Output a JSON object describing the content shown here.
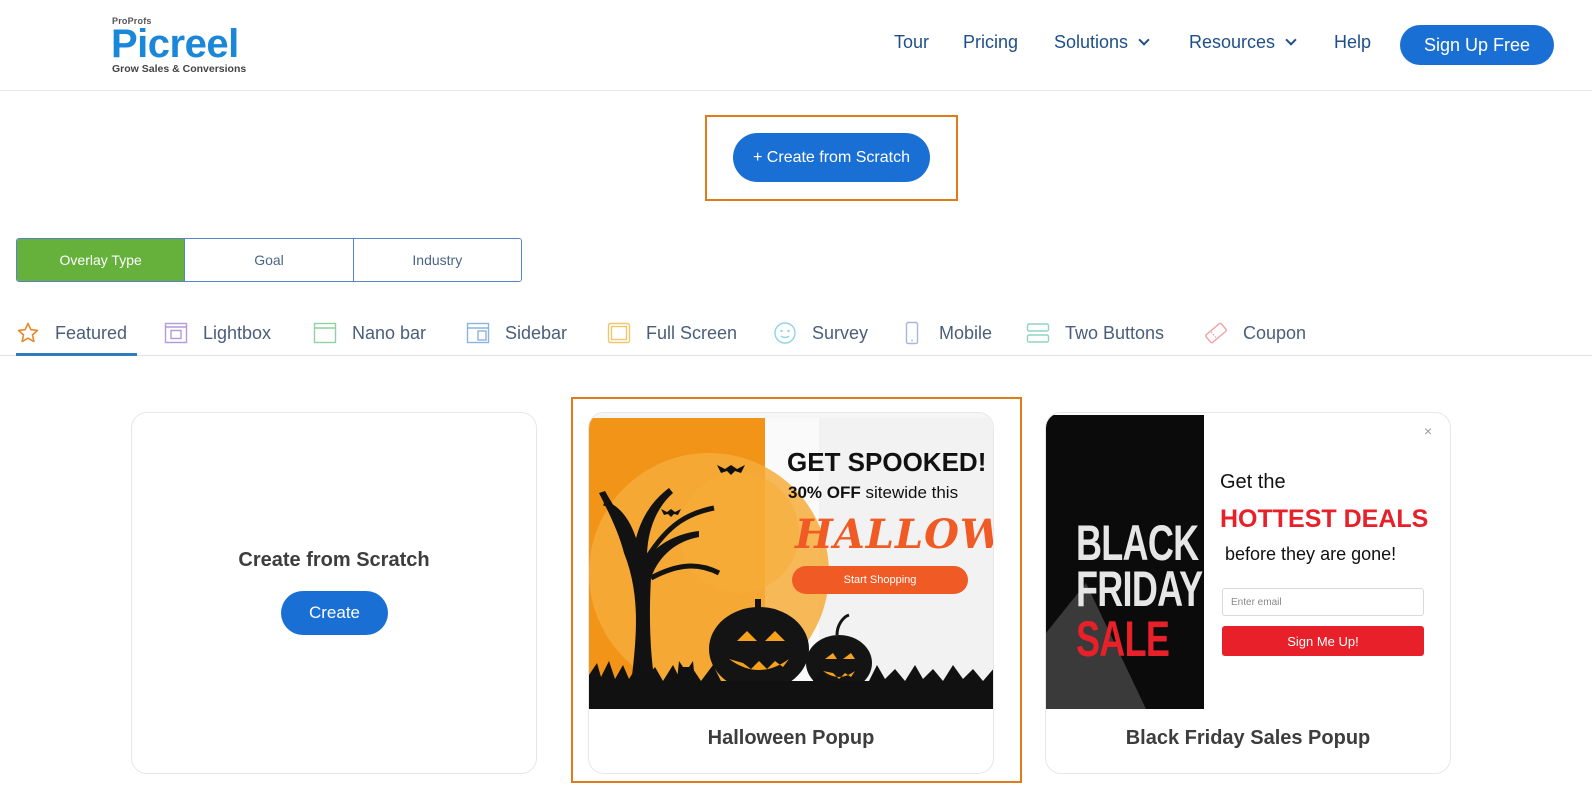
{
  "header": {
    "logo": {
      "top": "ProProfs",
      "main": "Picreel",
      "tagline": "Grow Sales & Conversions"
    },
    "nav": [
      {
        "label": "Tour"
      },
      {
        "label": "Pricing"
      },
      {
        "label": "Solutions",
        "dropdown": true
      },
      {
        "label": "Resources",
        "dropdown": true
      },
      {
        "label": "Help"
      }
    ],
    "signup_label": "Sign Up Free"
  },
  "create_scratch_button": "+ Create from Scratch",
  "filter_segments": [
    {
      "label": "Overlay Type",
      "active": true
    },
    {
      "label": "Goal",
      "active": false
    },
    {
      "label": "Industry",
      "active": false
    }
  ],
  "tabs": [
    {
      "label": "Featured",
      "icon": "star-icon",
      "active": true
    },
    {
      "label": "Lightbox",
      "icon": "lightbox-icon"
    },
    {
      "label": "Nano bar",
      "icon": "nano-bar-icon"
    },
    {
      "label": "Sidebar",
      "icon": "sidebar-icon"
    },
    {
      "label": "Full Screen",
      "icon": "full-screen-icon"
    },
    {
      "label": "Survey",
      "icon": "survey-icon"
    },
    {
      "label": "Mobile",
      "icon": "mobile-icon"
    },
    {
      "label": "Two Buttons",
      "icon": "two-buttons-icon"
    },
    {
      "label": "Coupon",
      "icon": "coupon-icon"
    }
  ],
  "cards": {
    "scratch": {
      "title": "Create from Scratch",
      "button": "Create"
    },
    "halloween": {
      "title": "Halloween Popup",
      "headline": "GET SPOOKED!",
      "offer_bold": "30% OFF",
      "offer_rest": "sitewide this",
      "script": "HALLOWEEN",
      "button": "Start Shopping"
    },
    "blackfriday": {
      "title": "Black Friday Sales Popup",
      "left_line1": "BLACK",
      "left_line2": "FRIDAY",
      "left_line3": "SALE",
      "line1": "Get the",
      "line2": "HOTTEST DEALS",
      "line3": "before they are gone!",
      "email_placeholder": "Enter email",
      "button": "Sign Me Up!",
      "close": "×"
    }
  },
  "colors": {
    "brand_blue": "#1a6fd4",
    "active_green": "#66b13c",
    "highlight_orange": "#e07b1a",
    "halloween_orange": "#f05a24",
    "deal_red": "#e8202a"
  }
}
